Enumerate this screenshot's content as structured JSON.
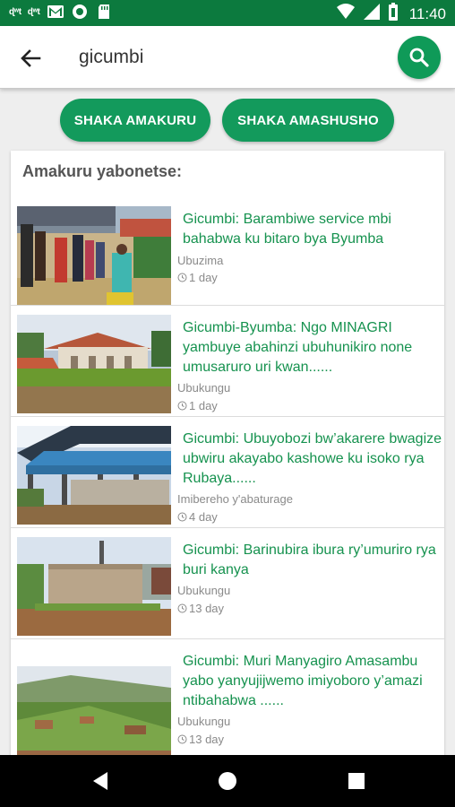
{
  "status_bar": {
    "notif1": "ɖʷt",
    "notif2": "ɖʷt",
    "time": "11:40"
  },
  "search": {
    "value": "gicumbi",
    "placeholder": ""
  },
  "buttons": {
    "news": "SHAKA AMAKURU",
    "photos": "SHAKA AMASHUSHO"
  },
  "results": {
    "heading": "Amakuru yabonetse:",
    "items": [
      {
        "title": "Gicumbi: Barambiwe service mbi bahabwa  ku bitaro bya Byumba",
        "category": "Ubuzima",
        "time": "1 day"
      },
      {
        "title": "Gicumbi-Byumba: Ngo MINAGRI yambuye abahinzi ubuhunikiro none umusaruro uri kwan......",
        "category": "Ubukungu",
        "time": "1 day"
      },
      {
        "title": "Gicumbi: Ubuyobozi bw’akarere bwagize ubwiru akayabo kashowe ku isoko rya Rubaya......",
        "category": "Imibereho y'abaturage",
        "time": "4 day"
      },
      {
        "title": "Gicumbi: Barinubira ibura ry’umuriro rya buri kanya",
        "category": "Ubukungu",
        "time": "13 day"
      },
      {
        "title": "Gicumbi: Muri Manyagiro Amasambu yabo yanyujijwemo imiyoboro y’amazi ntibahabwa ......",
        "category": "Ubukungu",
        "time": "13 day"
      }
    ]
  },
  "colors": {
    "status_bar": "#0c7a3e",
    "accent": "#139a5c",
    "title_text": "#16924f"
  },
  "icons": [
    "back-arrow-icon",
    "search-icon",
    "clock-icon",
    "back-nav-icon",
    "home-nav-icon",
    "recents-nav-icon",
    "wifi-icon",
    "signal-icon",
    "battery-icon"
  ]
}
